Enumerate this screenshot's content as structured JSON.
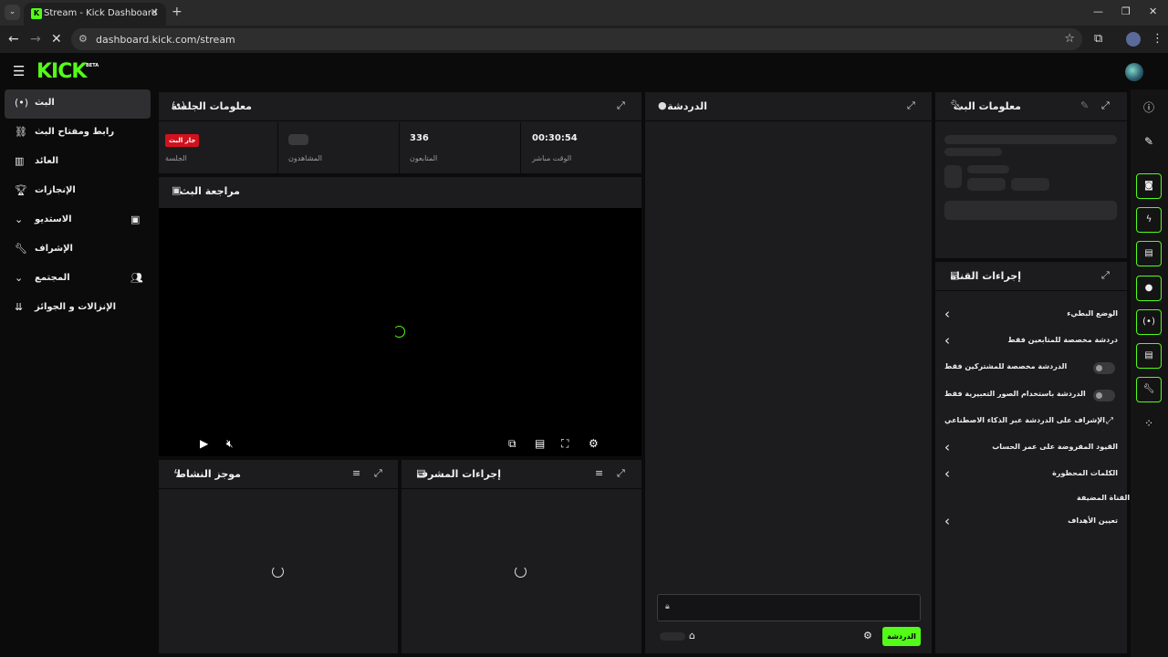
{
  "browser": {
    "tab_title": "Stream - Kick Dashboard",
    "url": "dashboard.kick.com/stream"
  },
  "app": {
    "logo": "KICK",
    "beta": "BETA"
  },
  "sidebar": {
    "items": [
      {
        "label": "البث",
        "icon": "broadcast-icon"
      },
      {
        "label": "رابط ومفتاح البث",
        "icon": "link-icon"
      },
      {
        "label": "العائد",
        "icon": "revenue-chart-icon"
      },
      {
        "label": "الإنجازات",
        "icon": "trophy-icon"
      },
      {
        "label": "الاستديو",
        "icon": "studio-icon"
      },
      {
        "label": "الإشراف",
        "icon": "wrench-icon"
      },
      {
        "label": "المجتمع",
        "icon": "community-icon"
      },
      {
        "label": "الإنزالات و الجوائز",
        "icon": "drops-icon"
      }
    ]
  },
  "session": {
    "title": "معلومات الجلسة",
    "live_badge": "جار البث",
    "session_label": "الجلسة",
    "viewers_label": "المشاهدون",
    "followers_value": "336",
    "followers_label": "المتابعون",
    "uptime_value": "00:30:54",
    "uptime_label": "الوقت مباشر"
  },
  "preview": {
    "title": "مراجعة البث"
  },
  "activity": {
    "title": "موجز النشاط"
  },
  "mod_actions": {
    "title": "إجراءات المشرف"
  },
  "chat": {
    "title": "الدردشة",
    "send_label": "الدردشة"
  },
  "stream_info": {
    "title": "معلومات البث"
  },
  "channel_actions": {
    "title": "إجراءات القناة",
    "rows": [
      {
        "label": "الوضع البطيء",
        "control": "chevron"
      },
      {
        "label": "دردشة مخصصة للمتابعين فقط",
        "control": "chevron"
      },
      {
        "label": "الدردشة مخصصة للمشتركين فقط",
        "control": "toggle"
      },
      {
        "label": "الدردشة باستخدام الصور التعبيرية فقط",
        "control": "toggle"
      },
      {
        "label": "الإشراف على الدردشة عبر الذكاء الاصطناعي",
        "control": "external"
      },
      {
        "label": "القيود المفروضة على عمر الحساب",
        "control": "chevron"
      },
      {
        "label": "الكلمات المحظورة",
        "control": "chevron"
      }
    ],
    "section_label": "القناة المضيفة",
    "goals_label": "تعيين الأهداف"
  },
  "colors": {
    "accent": "#53fc18",
    "live": "#d1121e",
    "panel": "#1c1c1e"
  }
}
